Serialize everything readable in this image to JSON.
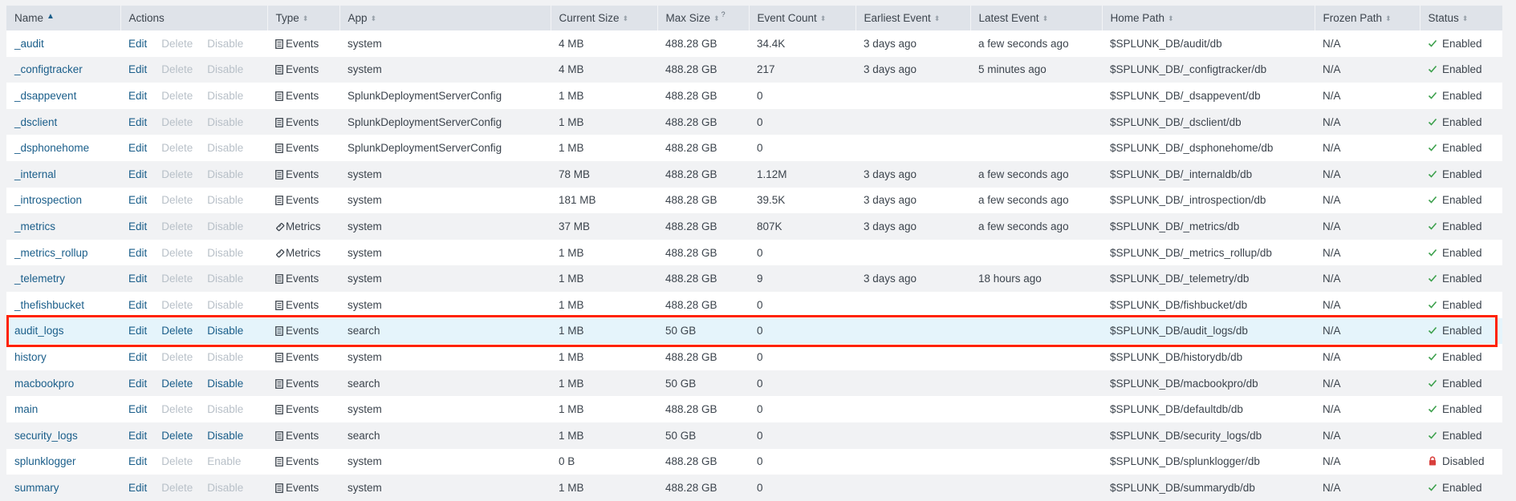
{
  "columns": {
    "name": "Name",
    "actions": "Actions",
    "type": "Type",
    "app": "App",
    "current_size": "Current Size",
    "max_size": "Max Size",
    "max_size_help": "?",
    "event_count": "Event Count",
    "earliest_event": "Earliest Event",
    "latest_event": "Latest Event",
    "home_path": "Home Path",
    "frozen_path": "Frozen Path",
    "status": "Status"
  },
  "sort": {
    "column": "name",
    "direction": "ascending"
  },
  "colors": {
    "link": "#1a5e8a",
    "disabled_action": "#b8c0c8",
    "enabled_status": "#3ca04c",
    "disabled_status": "#d93f3c",
    "highlight_row": "#e5f4fb",
    "highlight_border": "#ff2200"
  },
  "rows": [
    {
      "name": "_audit",
      "edit": "Edit",
      "delete": "Delete",
      "delete_enabled": false,
      "toggle": "Disable",
      "toggle_enabled": false,
      "type": "Events",
      "type_icon": "events-icon",
      "app": "system",
      "current_size": "4 MB",
      "max_size": "488.28 GB",
      "event_count": "34.4K",
      "earliest_event": "3 days ago",
      "latest_event": "a few seconds ago",
      "home_path": "$SPLUNK_DB/audit/db",
      "frozen_path": "N/A",
      "status": "Enabled",
      "status_icon": "check-icon"
    },
    {
      "name": "_configtracker",
      "edit": "Edit",
      "delete": "Delete",
      "delete_enabled": false,
      "toggle": "Disable",
      "toggle_enabled": false,
      "type": "Events",
      "type_icon": "events-icon",
      "app": "system",
      "current_size": "4 MB",
      "max_size": "488.28 GB",
      "event_count": "217",
      "earliest_event": "3 days ago",
      "latest_event": "5 minutes ago",
      "home_path": "$SPLUNK_DB/_configtracker/db",
      "frozen_path": "N/A",
      "status": "Enabled",
      "status_icon": "check-icon"
    },
    {
      "name": "_dsappevent",
      "edit": "Edit",
      "delete": "Delete",
      "delete_enabled": false,
      "toggle": "Disable",
      "toggle_enabled": false,
      "type": "Events",
      "type_icon": "events-icon",
      "app": "SplunkDeploymentServerConfig",
      "current_size": "1 MB",
      "max_size": "488.28 GB",
      "event_count": "0",
      "earliest_event": "",
      "latest_event": "",
      "home_path": "$SPLUNK_DB/_dsappevent/db",
      "frozen_path": "N/A",
      "status": "Enabled",
      "status_icon": "check-icon"
    },
    {
      "name": "_dsclient",
      "edit": "Edit",
      "delete": "Delete",
      "delete_enabled": false,
      "toggle": "Disable",
      "toggle_enabled": false,
      "type": "Events",
      "type_icon": "events-icon",
      "app": "SplunkDeploymentServerConfig",
      "current_size": "1 MB",
      "max_size": "488.28 GB",
      "event_count": "0",
      "earliest_event": "",
      "latest_event": "",
      "home_path": "$SPLUNK_DB/_dsclient/db",
      "frozen_path": "N/A",
      "status": "Enabled",
      "status_icon": "check-icon"
    },
    {
      "name": "_dsphonehome",
      "edit": "Edit",
      "delete": "Delete",
      "delete_enabled": false,
      "toggle": "Disable",
      "toggle_enabled": false,
      "type": "Events",
      "type_icon": "events-icon",
      "app": "SplunkDeploymentServerConfig",
      "current_size": "1 MB",
      "max_size": "488.28 GB",
      "event_count": "0",
      "earliest_event": "",
      "latest_event": "",
      "home_path": "$SPLUNK_DB/_dsphonehome/db",
      "frozen_path": "N/A",
      "status": "Enabled",
      "status_icon": "check-icon"
    },
    {
      "name": "_internal",
      "edit": "Edit",
      "delete": "Delete",
      "delete_enabled": false,
      "toggle": "Disable",
      "toggle_enabled": false,
      "type": "Events",
      "type_icon": "events-icon",
      "app": "system",
      "current_size": "78 MB",
      "max_size": "488.28 GB",
      "event_count": "1.12M",
      "earliest_event": "3 days ago",
      "latest_event": "a few seconds ago",
      "home_path": "$SPLUNK_DB/_internaldb/db",
      "frozen_path": "N/A",
      "status": "Enabled",
      "status_icon": "check-icon"
    },
    {
      "name": "_introspection",
      "edit": "Edit",
      "delete": "Delete",
      "delete_enabled": false,
      "toggle": "Disable",
      "toggle_enabled": false,
      "type": "Events",
      "type_icon": "events-icon",
      "app": "system",
      "current_size": "181 MB",
      "max_size": "488.28 GB",
      "event_count": "39.5K",
      "earliest_event": "3 days ago",
      "latest_event": "a few seconds ago",
      "home_path": "$SPLUNK_DB/_introspection/db",
      "frozen_path": "N/A",
      "status": "Enabled",
      "status_icon": "check-icon"
    },
    {
      "name": "_metrics",
      "edit": "Edit",
      "delete": "Delete",
      "delete_enabled": false,
      "toggle": "Disable",
      "toggle_enabled": false,
      "type": "Metrics",
      "type_icon": "metrics-icon",
      "app": "system",
      "current_size": "37 MB",
      "max_size": "488.28 GB",
      "event_count": "807K",
      "earliest_event": "3 days ago",
      "latest_event": "a few seconds ago",
      "home_path": "$SPLUNK_DB/_metrics/db",
      "frozen_path": "N/A",
      "status": "Enabled",
      "status_icon": "check-icon"
    },
    {
      "name": "_metrics_rollup",
      "edit": "Edit",
      "delete": "Delete",
      "delete_enabled": false,
      "toggle": "Disable",
      "toggle_enabled": false,
      "type": "Metrics",
      "type_icon": "metrics-icon",
      "app": "system",
      "current_size": "1 MB",
      "max_size": "488.28 GB",
      "event_count": "0",
      "earliest_event": "",
      "latest_event": "",
      "home_path": "$SPLUNK_DB/_metrics_rollup/db",
      "frozen_path": "N/A",
      "status": "Enabled",
      "status_icon": "check-icon"
    },
    {
      "name": "_telemetry",
      "edit": "Edit",
      "delete": "Delete",
      "delete_enabled": false,
      "toggle": "Disable",
      "toggle_enabled": false,
      "type": "Events",
      "type_icon": "events-icon",
      "app": "system",
      "current_size": "1 MB",
      "max_size": "488.28 GB",
      "event_count": "9",
      "earliest_event": "3 days ago",
      "latest_event": "18 hours ago",
      "home_path": "$SPLUNK_DB/_telemetry/db",
      "frozen_path": "N/A",
      "status": "Enabled",
      "status_icon": "check-icon"
    },
    {
      "name": "_thefishbucket",
      "edit": "Edit",
      "delete": "Delete",
      "delete_enabled": false,
      "toggle": "Disable",
      "toggle_enabled": false,
      "type": "Events",
      "type_icon": "events-icon",
      "app": "system",
      "current_size": "1 MB",
      "max_size": "488.28 GB",
      "event_count": "0",
      "earliest_event": "",
      "latest_event": "",
      "home_path": "$SPLUNK_DB/fishbucket/db",
      "frozen_path": "N/A",
      "status": "Enabled",
      "status_icon": "check-icon"
    },
    {
      "name": "audit_logs",
      "edit": "Edit",
      "delete": "Delete",
      "delete_enabled": true,
      "toggle": "Disable",
      "toggle_enabled": true,
      "type": "Events",
      "type_icon": "events-icon",
      "app": "search",
      "current_size": "1 MB",
      "max_size": "50 GB",
      "event_count": "0",
      "earliest_event": "",
      "latest_event": "",
      "home_path": "$SPLUNK_DB/audit_logs/db",
      "frozen_path": "N/A",
      "status": "Enabled",
      "status_icon": "check-icon",
      "highlighted": true
    },
    {
      "name": "history",
      "edit": "Edit",
      "delete": "Delete",
      "delete_enabled": false,
      "toggle": "Disable",
      "toggle_enabled": false,
      "type": "Events",
      "type_icon": "events-icon",
      "app": "system",
      "current_size": "1 MB",
      "max_size": "488.28 GB",
      "event_count": "0",
      "earliest_event": "",
      "latest_event": "",
      "home_path": "$SPLUNK_DB/historydb/db",
      "frozen_path": "N/A",
      "status": "Enabled",
      "status_icon": "check-icon"
    },
    {
      "name": "macbookpro",
      "edit": "Edit",
      "delete": "Delete",
      "delete_enabled": true,
      "toggle": "Disable",
      "toggle_enabled": true,
      "type": "Events",
      "type_icon": "events-icon",
      "app": "search",
      "current_size": "1 MB",
      "max_size": "50 GB",
      "event_count": "0",
      "earliest_event": "",
      "latest_event": "",
      "home_path": "$SPLUNK_DB/macbookpro/db",
      "frozen_path": "N/A",
      "status": "Enabled",
      "status_icon": "check-icon"
    },
    {
      "name": "main",
      "edit": "Edit",
      "delete": "Delete",
      "delete_enabled": false,
      "toggle": "Disable",
      "toggle_enabled": false,
      "type": "Events",
      "type_icon": "events-icon",
      "app": "system",
      "current_size": "1 MB",
      "max_size": "488.28 GB",
      "event_count": "0",
      "earliest_event": "",
      "latest_event": "",
      "home_path": "$SPLUNK_DB/defaultdb/db",
      "frozen_path": "N/A",
      "status": "Enabled",
      "status_icon": "check-icon"
    },
    {
      "name": "security_logs",
      "edit": "Edit",
      "delete": "Delete",
      "delete_enabled": true,
      "toggle": "Disable",
      "toggle_enabled": true,
      "type": "Events",
      "type_icon": "events-icon",
      "app": "search",
      "current_size": "1 MB",
      "max_size": "50 GB",
      "event_count": "0",
      "earliest_event": "",
      "latest_event": "",
      "home_path": "$SPLUNK_DB/security_logs/db",
      "frozen_path": "N/A",
      "status": "Enabled",
      "status_icon": "check-icon"
    },
    {
      "name": "splunklogger",
      "edit": "Edit",
      "delete": "Delete",
      "delete_enabled": false,
      "toggle": "Enable",
      "toggle_enabled": false,
      "type": "Events",
      "type_icon": "events-icon",
      "app": "system",
      "current_size": "0 B",
      "max_size": "488.28 GB",
      "event_count": "0",
      "earliest_event": "",
      "latest_event": "",
      "home_path": "$SPLUNK_DB/splunklogger/db",
      "frozen_path": "N/A",
      "status": "Disabled",
      "status_icon": "lock-icon"
    },
    {
      "name": "summary",
      "edit": "Edit",
      "delete": "Delete",
      "delete_enabled": false,
      "toggle": "Disable",
      "toggle_enabled": false,
      "type": "Events",
      "type_icon": "events-icon",
      "app": "system",
      "current_size": "1 MB",
      "max_size": "488.28 GB",
      "event_count": "0",
      "earliest_event": "",
      "latest_event": "",
      "home_path": "$SPLUNK_DB/summarydb/db",
      "frozen_path": "N/A",
      "status": "Enabled",
      "status_icon": "check-icon"
    }
  ]
}
